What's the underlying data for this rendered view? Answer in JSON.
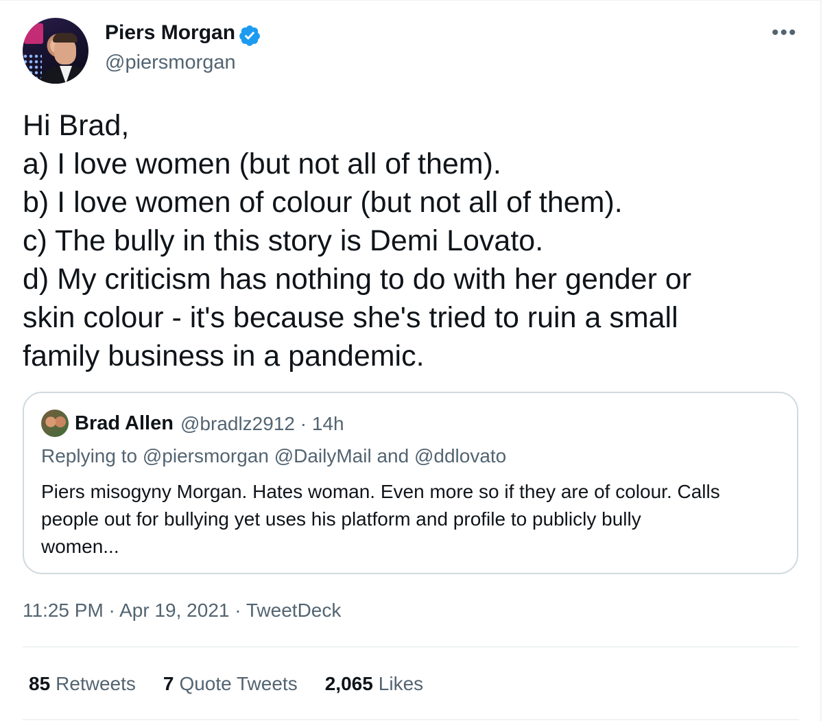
{
  "author": {
    "name": "Piers Morgan",
    "handle": "@piersmorgan",
    "verified_color": "#1d9bf0"
  },
  "more_label": "•••",
  "tweet": {
    "lines": [
      "Hi Brad,",
      "a) I love women (but not all of them).",
      "b) I love women of colour (but not all of them).",
      "c) The bully in this story is Demi Lovato.",
      "d) My criticism has nothing to do with her gender or",
      "skin colour - it's because she's tried to ruin a small",
      "family business in a pandemic."
    ]
  },
  "quoted": {
    "name": "Brad Allen",
    "meta": "@bradlz2912 · 14h",
    "replying": "Replying to @piersmorgan @DailyMail and @ddlovato",
    "body_lines": [
      "Piers misogyny Morgan. Hates woman. Even more so if they are of colour. Calls",
      "people out for bullying yet uses his platform and profile to publicly bully",
      "women..."
    ]
  },
  "timestamp": {
    "time": "11:25 PM",
    "date": "Apr 19, 2021",
    "source": "TweetDeck",
    "sep": " · "
  },
  "stats": {
    "retweets_count": "85",
    "retweets_label": "Retweets",
    "quotes_count": "7",
    "quotes_label": "Quote Tweets",
    "likes_count": "2,065",
    "likes_label": "Likes"
  }
}
